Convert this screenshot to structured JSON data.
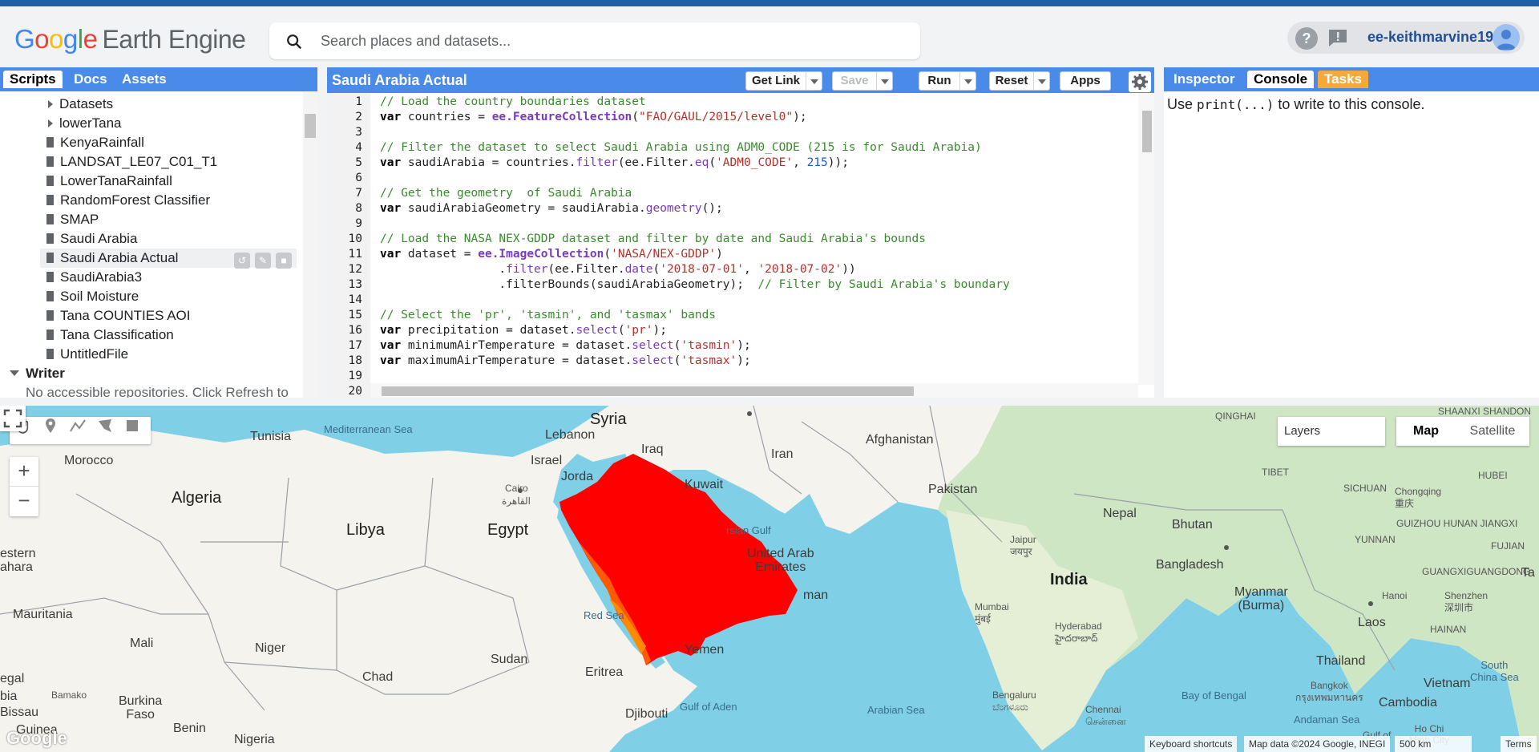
{
  "header": {
    "logo_google": [
      "G",
      "o",
      "o",
      "g",
      "l",
      "e"
    ],
    "logo_product": "Earth Engine",
    "search_placeholder": "Search places and datasets...",
    "account_name": "ee-keithmarvine19"
  },
  "left_panel": {
    "tabs": [
      "Scripts",
      "Docs",
      "Assets"
    ],
    "active_tab": "Scripts",
    "tree": [
      {
        "label": "Datasets",
        "type": "folder"
      },
      {
        "label": "lowerTana",
        "type": "folder"
      },
      {
        "label": "KenyaRainfall",
        "type": "file"
      },
      {
        "label": "LANDSAT_LE07_C01_T1",
        "type": "file"
      },
      {
        "label": "LowerTanaRainfall",
        "type": "file"
      },
      {
        "label": "RandomForest Classifier",
        "type": "file"
      },
      {
        "label": "SMAP",
        "type": "file"
      },
      {
        "label": "Saudi Arabia",
        "type": "file"
      },
      {
        "label": "Saudi Arabia Actual",
        "type": "file",
        "selected": true
      },
      {
        "label": "SaudiArabia3",
        "type": "file"
      },
      {
        "label": "Soil Moisture",
        "type": "file"
      },
      {
        "label": "Tana COUNTIES AOI",
        "type": "file"
      },
      {
        "label": "Tana Classification",
        "type": "file"
      },
      {
        "label": "UntitledFile",
        "type": "file"
      }
    ],
    "writer_section": "Writer",
    "writer_message": "No accessible repositories. Click Refresh to"
  },
  "editor": {
    "title": "Saudi Arabia Actual",
    "buttons": {
      "get_link": "Get Link",
      "save": "Save",
      "run": "Run",
      "reset": "Reset",
      "apps": "Apps"
    },
    "line_numbers": [
      "1",
      "2",
      "3",
      "4",
      "5",
      "6",
      "7",
      "8",
      "9",
      "10",
      "11",
      "12",
      "13",
      "14",
      "15",
      "16",
      "17",
      "18",
      "19",
      "20"
    ]
  },
  "right_panel": {
    "tabs": [
      "Inspector",
      "Console",
      "Tasks"
    ],
    "active_tab": "Console",
    "console_prefix": "Use",
    "console_code": "print(...)",
    "console_suffix": "to write to this console."
  },
  "map": {
    "layers_label": "Layers",
    "map_type_options": [
      "Map",
      "Satellite"
    ],
    "selected_map_type": "Map",
    "labels": {
      "syria": "Syria",
      "lebanon": "Lebanon",
      "tunisia": "Tunisia",
      "mediterranean": "Mediterranean Sea",
      "morocco": "Morocco",
      "algeria": "Algeria",
      "libya": "Libya",
      "egypt": "Egypt",
      "cairo": "Cairo",
      "cairo_ar": "القاهرة",
      "israel": "Israel",
      "jordan": "Jorda",
      "iraq": "Iraq",
      "iran": "Iran",
      "kuwait": "Kuwait",
      "afghanistan": "Afghanistan",
      "pakistan": "Pakistan",
      "persian_gulf": "rsian Gulf",
      "uae": "United Arab\nEmirates",
      "oman": "man",
      "yemen": "Yemen",
      "eritrea": "Eritrea",
      "djibouti": "Djibouti",
      "sudan": "Sudan",
      "chad": "Chad",
      "niger": "Niger",
      "mali": "Mali",
      "mauritania": "Mauritania",
      "western_sahara": "estern\nahara",
      "nigeria": "Nigeria",
      "benin": "Benin",
      "burkina": "Burkina\nFaso",
      "bamako": "Bamako",
      "guinea": "Guinea",
      "bissau": "Bissau",
      "egal": "egal",
      "bia": "bia",
      "red_sea": "Red Sea",
      "gulf_aden": "Gulf of Aden",
      "arabian_sea": "Arabian Sea",
      "india": "India",
      "nepal": "Nepal",
      "bhutan": "Bhutan",
      "bangladesh": "Bangladesh",
      "jaipur": "Jaipur\nजयपुर",
      "mumbai": "Mumbai\nमुंबई",
      "hyderabad": "Hyderabad\nహైదరాబాద్",
      "bengaluru": "Bengaluru\nಬೆಂಗಳೂರು",
      "chennai": "Chennai\nசென்னை",
      "bay_bengal": "Bay of Bengal",
      "andaman": "Andaman Sea",
      "myanmar": "Myanmar\n(Burma)",
      "laos": "Laos",
      "thailand": "Thailand",
      "bangkok": "Bangkok\nกรุงเทพมหานคร",
      "vietnam": "Vietnam",
      "cambodia": "Cambodia",
      "hanoi": "Hanoi",
      "south_china_sea": "South\nChina Sea",
      "ho_chi_minh": "Ho Chi\nMinh City",
      "shenzhen": "Shenzhen\n深圳市",
      "chongqing": "Chongqing\n重庆",
      "tibet": "TIBET",
      "sichuan": "SICHUAN",
      "hubei": "HUBEI",
      "yunnan": "YUNNAN",
      "guizhou": "GUIZHOU HUNAN JIANGXI",
      "guangxi": "GUANGXIGUANGDONG",
      "fujian": "FUJIAN",
      "hainan": "HAINAN",
      "shaanxi": "SHAANXI SHANDON",
      "xinjiang": "QINGHAI",
      "ta": "Ta",
      "gulf_of": "Gulf of"
    },
    "attribution": {
      "keyboard": "Keyboard shortcuts",
      "data": "Map data ©2024 Google, INEGI",
      "scale": "500 km",
      "terms": "Terms"
    },
    "google_watermark": "Google",
    "overlay_color": "#ff0000"
  }
}
